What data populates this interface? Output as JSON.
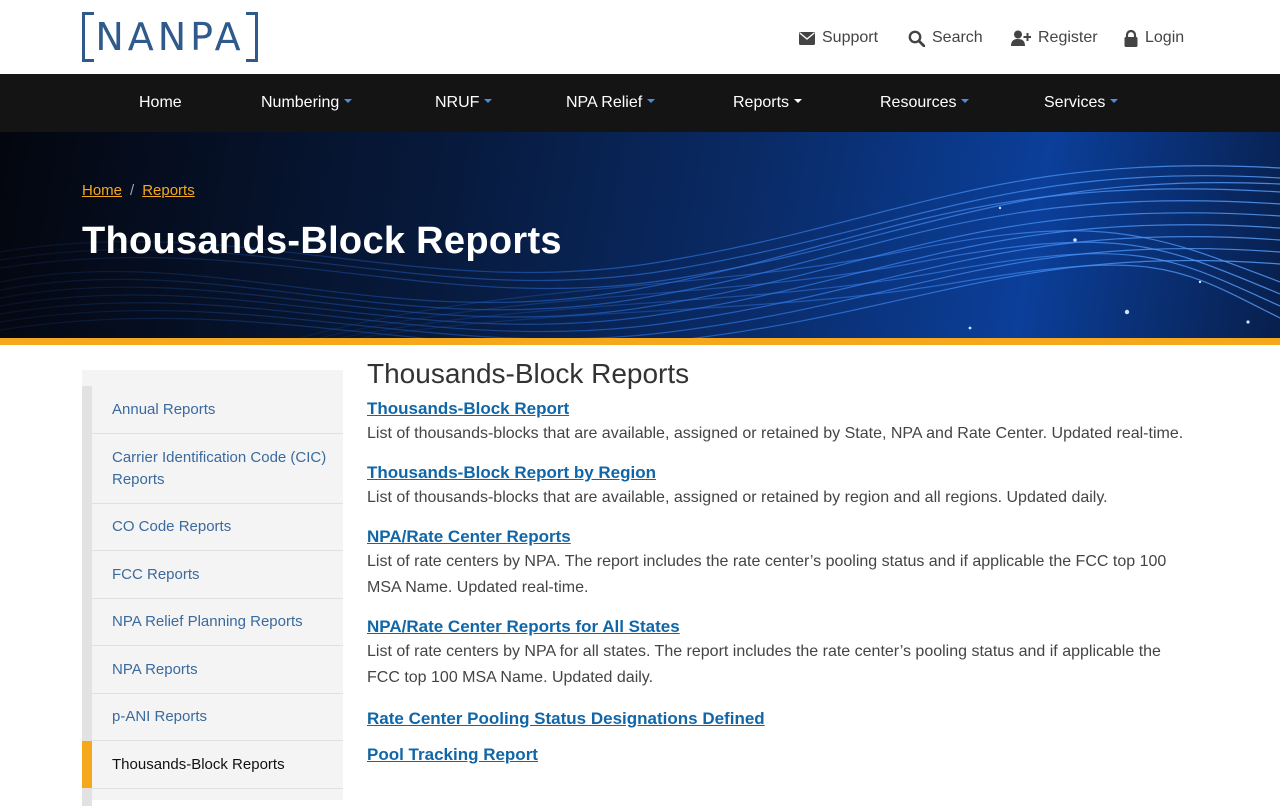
{
  "header": {
    "logo_text": "NANPA",
    "support_label": "Support",
    "search_label": "Search",
    "register_label": "Register",
    "login_label": "Login"
  },
  "nav": {
    "home": "Home",
    "numbering": "Numbering",
    "nruf": "NRUF",
    "npa_relief": "NPA Relief",
    "reports": "Reports",
    "resources": "Resources",
    "services": "Services"
  },
  "breadcrumb": {
    "home": "Home",
    "sep": "/",
    "reports": "Reports"
  },
  "hero": {
    "title": "Thousands-Block Reports"
  },
  "sidebar": {
    "items": [
      {
        "label": "Annual Reports"
      },
      {
        "label": "Carrier Identification Code (CIC) Reports"
      },
      {
        "label": "CO Code Reports"
      },
      {
        "label": "FCC Reports"
      },
      {
        "label": "NPA Relief Planning Reports"
      },
      {
        "label": "NPA Reports"
      },
      {
        "label": "p-ANI Reports"
      },
      {
        "label": "Thousands-Block Reports"
      }
    ]
  },
  "main": {
    "heading": "Thousands-Block Reports",
    "reports": [
      {
        "title": "Thousands-Block Report ",
        "desc": "List of thousands-blocks that are available, assigned or retained by State, NPA and Rate Center. Updated real-time."
      },
      {
        "title": "Thousands-Block Report by Region ",
        "desc": "List of thousands-blocks that are available, assigned or retained by region and all regions. Updated daily."
      },
      {
        "title": "NPA/Rate Center Reports ",
        "desc": "List of rate centers by NPA. The report includes the rate center’s pooling status and if applicable the FCC top 100 MSA Name. Updated real-time."
      },
      {
        "title": "NPA/Rate Center Reports for All States ",
        "desc": "List of rate centers by NPA for all states. The report includes the rate center’s pooling status and if applicable the FCC top 100 MSA Name. Updated daily."
      },
      {
        "title": "Rate Center Pooling Status Designations Defined",
        "desc": ""
      },
      {
        "title": "Pool Tracking Report",
        "desc": ""
      }
    ]
  },
  "colors": {
    "brand_blue": "#2f5a8c",
    "accent_orange": "#f6a81c",
    "nav_bg": "#141414",
    "link_blue": "#1066a8"
  }
}
